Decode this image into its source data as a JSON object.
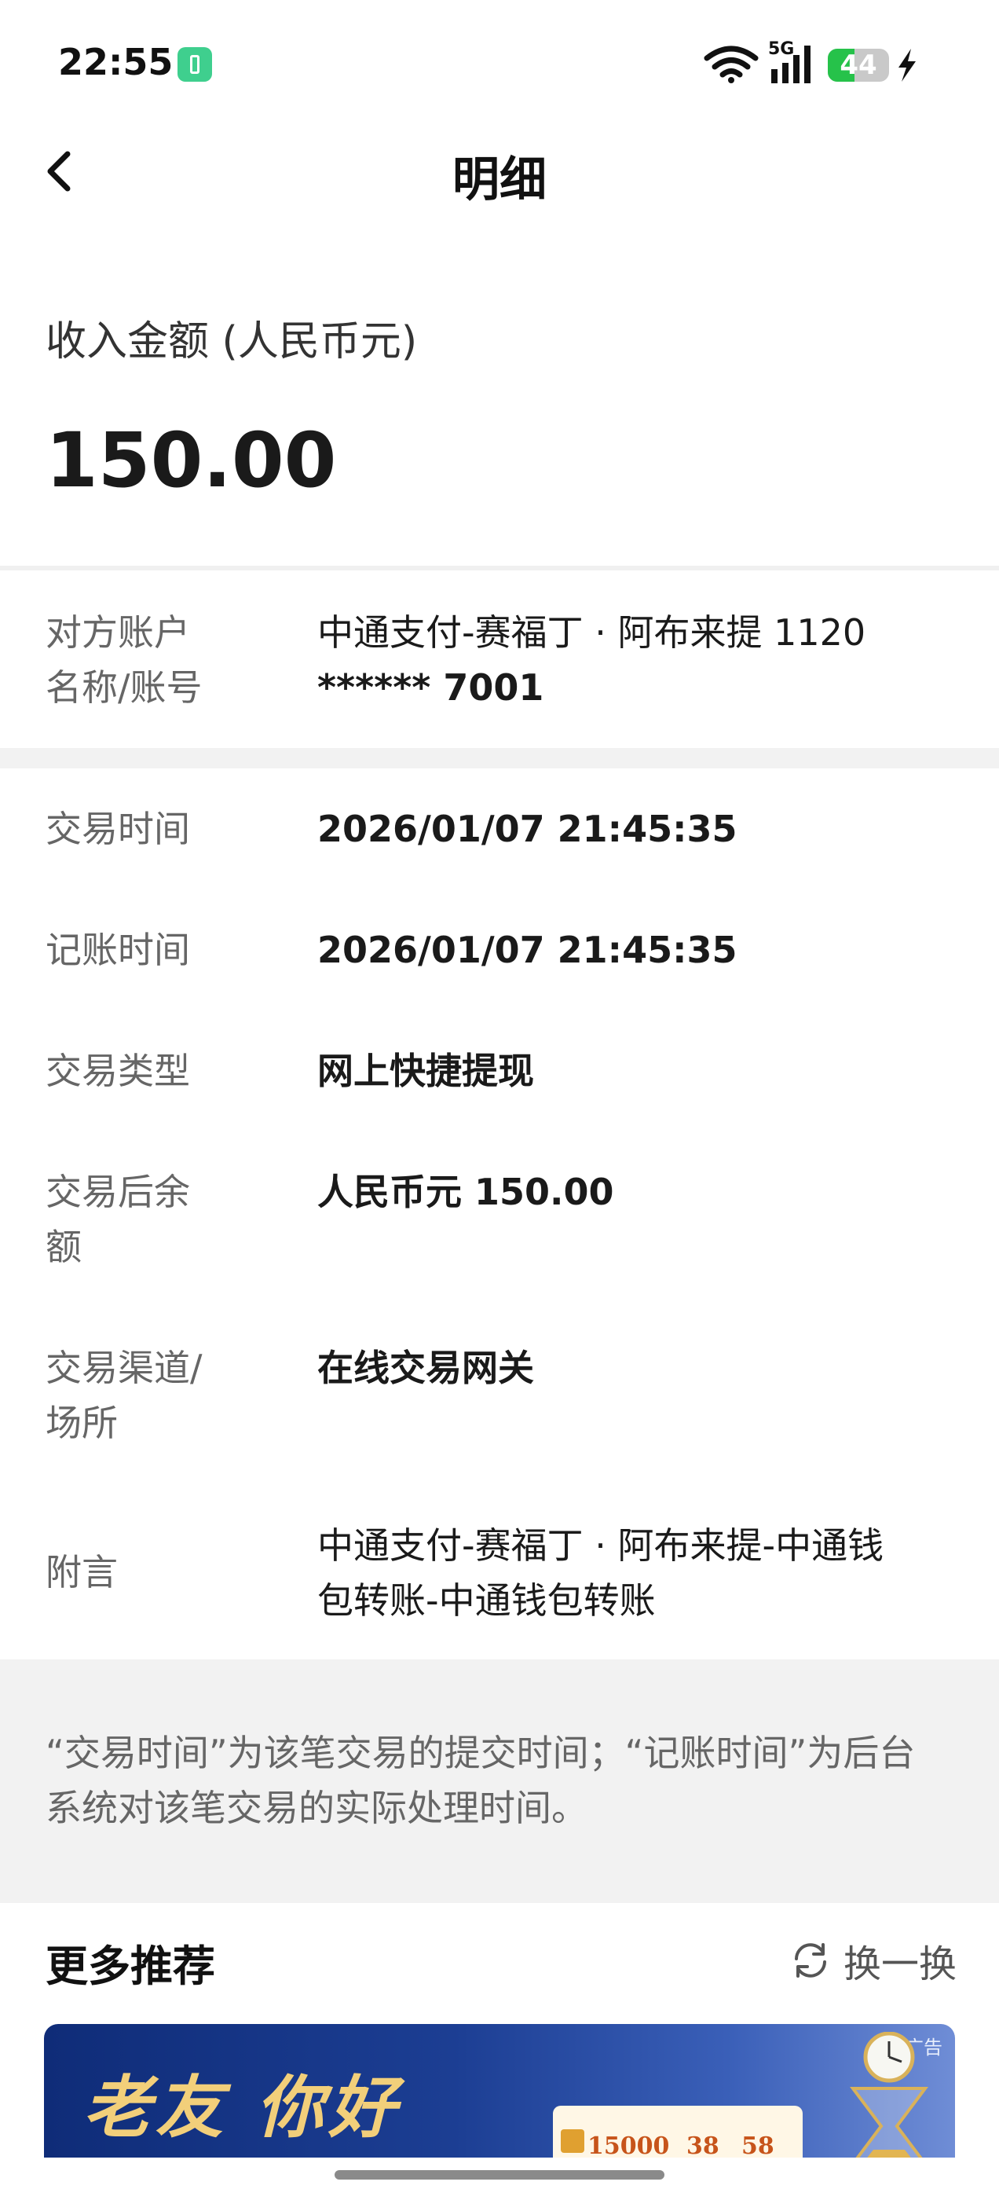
{
  "status_bar": {
    "time": "22:55",
    "network": "5G",
    "battery_level": 44,
    "battery_text": "44",
    "charging": true
  },
  "header": {
    "title": "明细",
    "back_icon": "chevron-left-icon"
  },
  "amount": {
    "label": "收入金额 (人民币元)",
    "value": "150.00"
  },
  "counterparty": {
    "label": "对方账户名称/账号",
    "label_line1": "对方账户",
    "label_line2": "名称/账号",
    "value_line1": "中通支付-赛福丁 · 阿布来提 1120",
    "value_line2": "****** 7001"
  },
  "details": [
    {
      "label_lines": [
        "交易时间"
      ],
      "value_lines": [
        "2026/01/07 21:45:35"
      ],
      "bold": true
    },
    {
      "label_lines": [
        "记账时间"
      ],
      "value_lines": [
        "2026/01/07 21:45:35"
      ],
      "bold": true
    },
    {
      "label_lines": [
        "交易类型"
      ],
      "value_lines": [
        "网上快捷提现"
      ],
      "bold": true
    },
    {
      "label_lines": [
        "交易后余",
        "额"
      ],
      "value_lines": [
        "人民币元 150.00"
      ],
      "bold": true
    },
    {
      "label_lines": [
        "交易渠道/",
        "场所"
      ],
      "value_lines": [
        "在线交易网关"
      ],
      "bold": true
    },
    {
      "label_lines": [
        "附言"
      ],
      "value_lines": [
        "中通支付-赛福丁 · 阿布来提-中通钱",
        "包转账-中通钱包转账"
      ],
      "bold": false
    }
  ],
  "note": {
    "line1": "“交易时间”为该笔交易的提交时间；“记账时间”为后台",
    "line2": "系统对该笔交易的实际处理时间。"
  },
  "recommendations": {
    "title": "更多推荐",
    "refresh_label": "换一换",
    "refresh_icon": "refresh-icon"
  },
  "banner": {
    "ad_tag": "广告",
    "headline": "老友 你好",
    "card_number": "15000",
    "card_values": [
      "38",
      "58"
    ]
  },
  "colors": {
    "accent_battery": "#26c24a",
    "banner_gold": "#f2cf7a",
    "banner_blue": "#1c3e93",
    "label_gray": "#666666"
  }
}
